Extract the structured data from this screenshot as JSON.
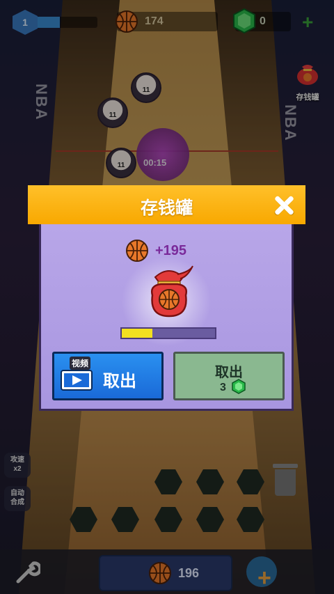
{
  "hud": {
    "level": "1",
    "coins": "174",
    "gems": "0",
    "plus": "+"
  },
  "side": {
    "piggy_bank_label": "存钱罐",
    "speed_label": "攻速\nx2",
    "auto_merge_label": "自动\n合成"
  },
  "scene": {
    "timer": "00:15",
    "jersey": "11"
  },
  "modal": {
    "title": "存钱罐",
    "reward_amount": "+195",
    "progress": 0.33,
    "video_tag": "视频",
    "video_button_label": "取出",
    "gem_button_label": "取出",
    "gem_cost": "3"
  },
  "bottom": {
    "coins": "196"
  },
  "colors": {
    "header": "#ffb814",
    "body": "#b09ee4",
    "video_button": "#1f7ce4",
    "gem_button": "#8ab890",
    "progress_fill": "#f2e020"
  }
}
